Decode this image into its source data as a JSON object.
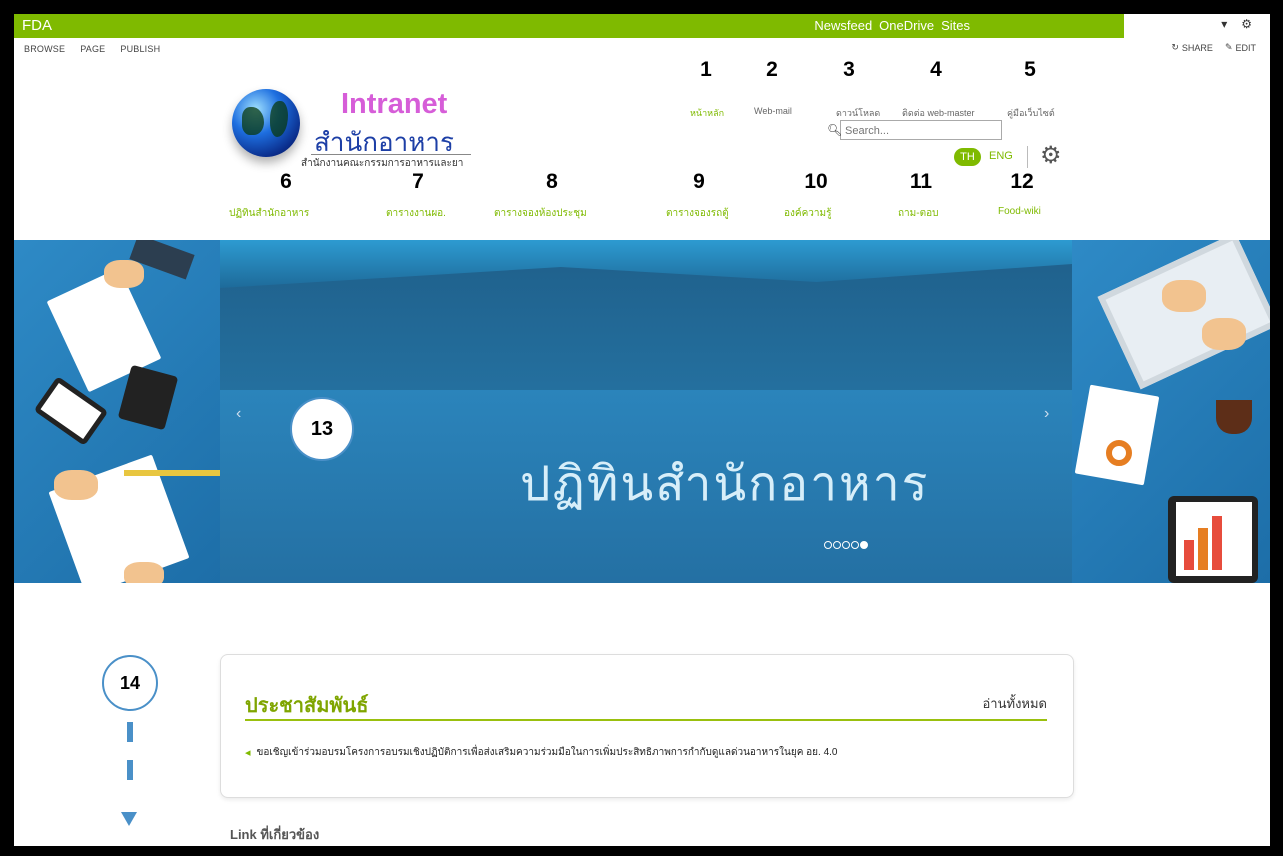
{
  "suite": {
    "brand": "FDA",
    "links": [
      "Newsfeed",
      "OneDrive",
      "Sites"
    ],
    "settings_icon": "gear-icon"
  },
  "ribbon": {
    "tabs": [
      "BROWSE",
      "PAGE",
      "PUBLISH"
    ],
    "share": "SHARE",
    "edit": "EDIT"
  },
  "logo": {
    "title": "Intranet",
    "subtitle": "สำนักอาหาร",
    "caption": "สำนักงานคณะกรรมการอาหารและยา"
  },
  "callouts": [
    "1",
    "2",
    "3",
    "4",
    "5",
    "6",
    "7",
    "8",
    "9",
    "10",
    "11",
    "12",
    "13",
    "14"
  ],
  "top_links": [
    "หน้าหลัก",
    "Web-mail",
    "ดาวน์โหลด",
    "ติดต่อ web-master",
    "คู่มือเว็บไซต์"
  ],
  "search": {
    "placeholder": "Search..."
  },
  "lang": {
    "th": "TH",
    "en": "ENG"
  },
  "nav": [
    "ปฏิทินสำนักอาหาร",
    "ตารางงานผอ.",
    "ตารางจองห้องประชุม",
    "ตารางจองรถตู้",
    "องค์ความรู้",
    "ถาม-ตอบ",
    "Food-wiki"
  ],
  "carousel": {
    "title": "ปฏิทินสำนักอาหาร",
    "prev": "‹",
    "next": "›",
    "slides": 5,
    "active_slide": 5
  },
  "news": {
    "title": "ประชาสัมพันธ์",
    "read_all": "อ่านทั้งหมด",
    "items": [
      "ขอเชิญเข้าร่วมอบรมโครงการอบรมเชิงปฏิบัติการเพื่อส่งเสริมความร่วมมือในการเพิ่มประสิทธิภาพการกำกับดูแลด่วนอาหารในยุค อย. 4.0"
    ]
  },
  "related": {
    "title": "Link ที่เกี่ยวข้อง"
  },
  "colors": {
    "accent": "#7fba00",
    "slide_bg": "#2a7db0",
    "callout_border": "#4a90c8"
  }
}
